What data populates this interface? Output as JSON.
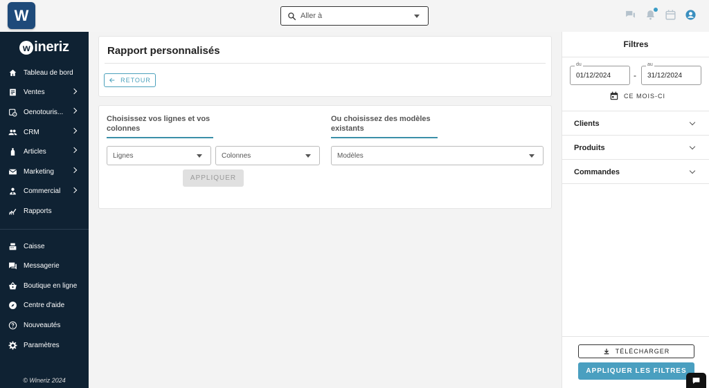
{
  "app": {
    "logo_letter": "W",
    "brand_name": "wineriz"
  },
  "topbar": {
    "goto_placeholder": "Aller à"
  },
  "sidebar": {
    "items": [
      {
        "label": "Tableau de bord",
        "icon": "home-icon",
        "has_children": false
      },
      {
        "label": "Ventes",
        "icon": "receipt-icon",
        "has_children": true
      },
      {
        "label": "Oenotouris...",
        "icon": "calendar-clock-icon",
        "has_children": true
      },
      {
        "label": "CRM",
        "icon": "people-icon",
        "has_children": true
      },
      {
        "label": "Articles",
        "icon": "bottle-icon",
        "has_children": true
      },
      {
        "label": "Marketing",
        "icon": "mail-icon",
        "has_children": true
      },
      {
        "label": "Commercial",
        "icon": "person-tie-icon",
        "has_children": true
      },
      {
        "label": "Rapports",
        "icon": "chart-icon",
        "has_children": false
      }
    ],
    "secondary": [
      {
        "label": "Caisse",
        "icon": "register-icon"
      },
      {
        "label": "Messagerie",
        "icon": "chat-icon"
      },
      {
        "label": "Boutique en ligne",
        "icon": "basket-icon"
      },
      {
        "label": "Centre d'aide",
        "icon": "compass-icon"
      },
      {
        "label": "Nouveautés",
        "icon": "question-icon"
      },
      {
        "label": "Paramètres",
        "icon": "gear-icon"
      }
    ],
    "copyright": "© Wineriz 2024"
  },
  "main": {
    "title": "Rapport personnalisés",
    "back_label": "RETOUR",
    "left_section_title_1": "Choisissez vos lignes et vos",
    "left_section_title_2": "colonnes",
    "right_section_title_1": "Ou choisissez des modèles",
    "right_section_title_2": "existants",
    "rows_label": "Lignes",
    "columns_label": "Colonnes",
    "models_label": "Modèles",
    "apply_label": "APPLIQUER"
  },
  "filters": {
    "title": "Filtres",
    "from_label": "du",
    "from_value": "01/12/2024",
    "to_label": "au",
    "to_value": "31/12/2024",
    "dash": "-",
    "month_label": "CE MOIS-CI",
    "sections": [
      "Clients",
      "Produits",
      "Commandes"
    ],
    "download_label": "TÉLÉCHARGER",
    "apply_label": "APPLIQUER LES FILTRES"
  },
  "colors": {
    "sidebar_bg": "#0f2233",
    "accent": "#4a9fc0",
    "logo_bg": "#1e4a7a"
  }
}
